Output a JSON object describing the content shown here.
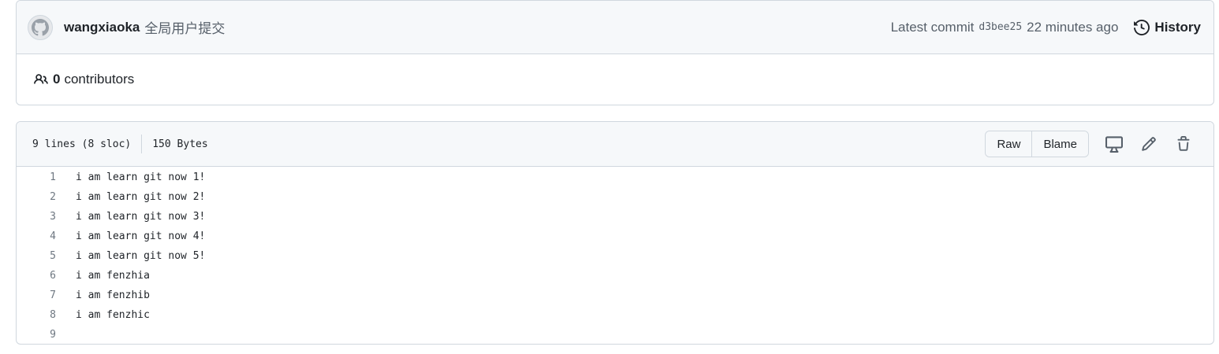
{
  "commit": {
    "author": "wangxiaoka",
    "message": "全局用户提交",
    "latest_label": "Latest commit",
    "sha": "d3bee25",
    "time_ago": "22 minutes ago",
    "history_label": "History"
  },
  "contributors": {
    "count": "0",
    "label": "contributors"
  },
  "file": {
    "lines_info": "9 lines (8 sloc)",
    "size": "150 Bytes",
    "actions": {
      "raw_label": "Raw",
      "blame_label": "Blame"
    },
    "icons": [
      "desktop-icon",
      "pencil-icon",
      "trash-icon"
    ],
    "lines": [
      {
        "num": "1",
        "text": "i am learn git now 1!"
      },
      {
        "num": "2",
        "text": "i am learn git now 2!"
      },
      {
        "num": "3",
        "text": "i am learn git now 3!"
      },
      {
        "num": "4",
        "text": "i am learn git now 4!"
      },
      {
        "num": "5",
        "text": "i am learn git now 5!"
      },
      {
        "num": "6",
        "text": "i am fenzhia"
      },
      {
        "num": "7",
        "text": "i am fenzhib"
      },
      {
        "num": "8",
        "text": "i am fenzhic"
      },
      {
        "num": "9",
        "text": ""
      }
    ]
  },
  "colors": {
    "border": "#d0d7de",
    "header_bg": "#f6f8fa",
    "text": "#1f2328",
    "muted": "#57606a"
  }
}
